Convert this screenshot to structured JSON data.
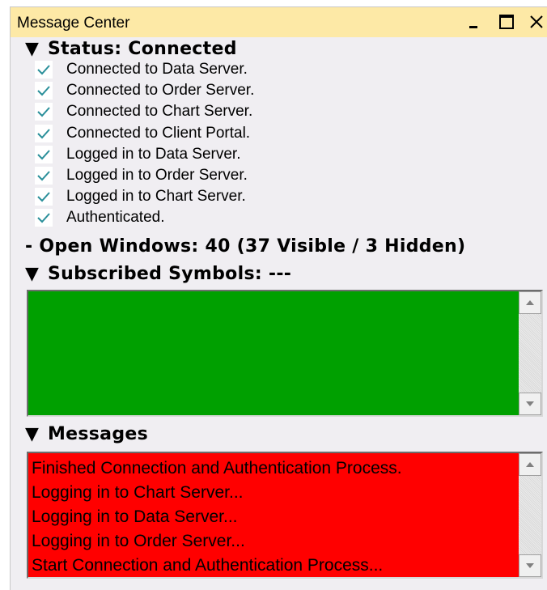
{
  "window": {
    "title": "Message Center"
  },
  "status": {
    "heading": "Status: Connected",
    "items": [
      "Connected to Data Server.",
      "Connected to Order Server.",
      "Connected to Chart Server.",
      "Connected to Client Portal.",
      "Logged in to Data Server.",
      "Logged in to Order Server.",
      "Logged in to Chart Server.",
      "Authenticated."
    ]
  },
  "open_windows": "- Open Windows: 40 (37 Visible / 3 Hidden)",
  "subscribed_symbols": {
    "heading": "Subscribed Symbols: ---"
  },
  "messages": {
    "heading": "Messages",
    "items": [
      "Finished Connection and Authentication Process.",
      "Logging in to Chart Server...",
      "Logging in to Data Server...",
      "Logging in to Order Server...",
      "Start Connection and Authentication Process..."
    ]
  },
  "colors": {
    "titlebar": "#fde9a6",
    "check": "#2a8f9a",
    "symbols_panel": "#00a000",
    "messages_panel": "#ff0000"
  }
}
